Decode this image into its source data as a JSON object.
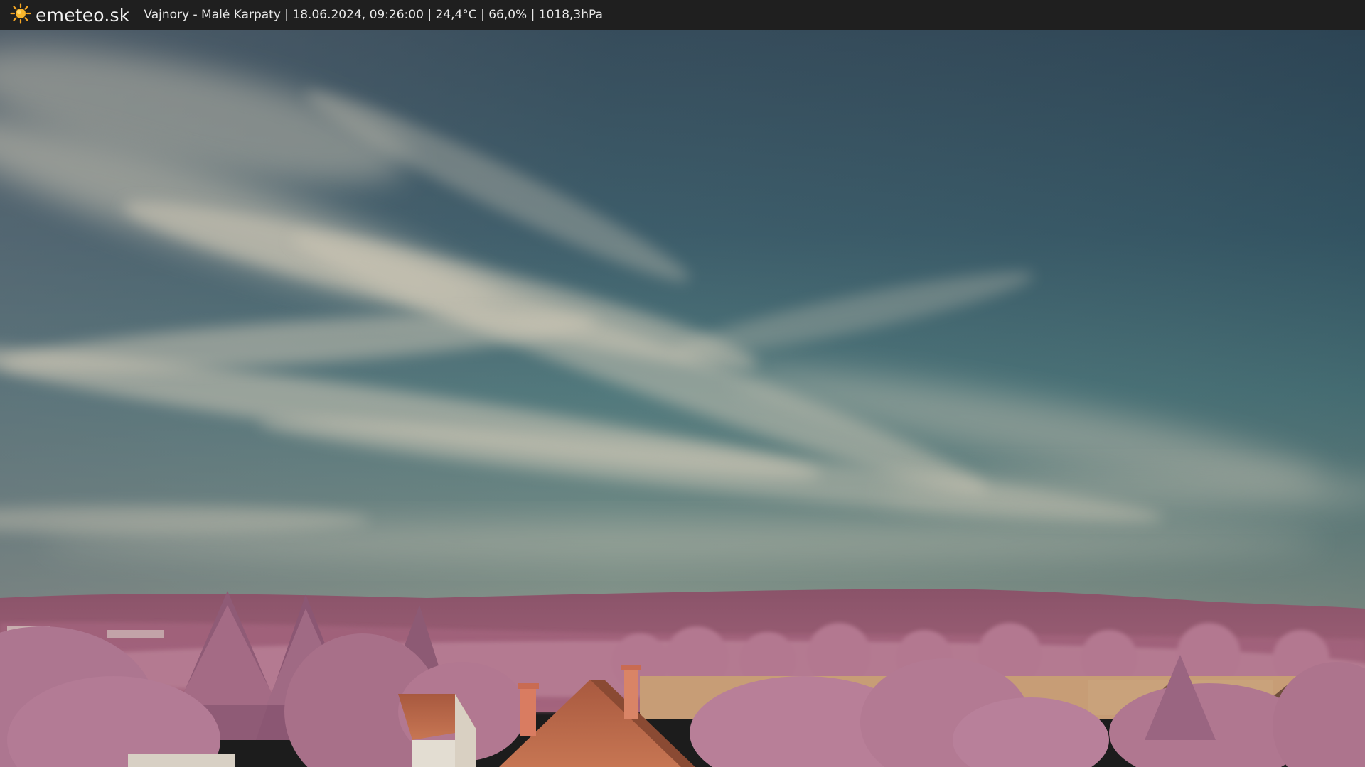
{
  "header": {
    "logo_text": "emeteo.sk",
    "caption": "Vajnory - Malé Karpaty | 18.06.2024, 09:26:00 | 24,4°C | 66,0% | 1018,3hPa"
  },
  "icons": {
    "logo": "sun-icon"
  },
  "colors": {
    "sky_top": "#2f4a5a",
    "sky_mid": "#3d6c76",
    "sky_horizon": "#7e938c",
    "clouds": "#c9c4b4",
    "foliage": "#b27590",
    "hills": "#93566f",
    "roof": "#c36a4d",
    "bar_background": "#1f1f1f"
  }
}
